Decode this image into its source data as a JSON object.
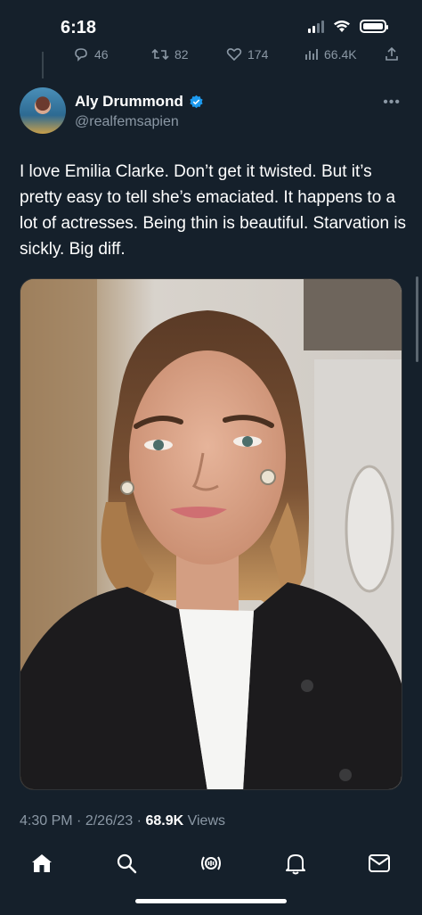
{
  "status_bar": {
    "time": "6:18"
  },
  "previous_tweet_actions": {
    "replies": "46",
    "retweets": "82",
    "likes": "174",
    "views": "66.4K"
  },
  "tweet": {
    "author_name": "Aly Drummond",
    "author_handle": "@realfemsapien",
    "text": "I love Emilia Clarke. Don’t get it twisted. But it’s pretty easy to tell she’s emaciated. It happens to a lot of actresses. Being thin is beautiful. Starvation is sickly. Big diff.",
    "time": "4:30 PM",
    "date": "2/26/23",
    "views_count": "68.9K",
    "views_label": "Views"
  },
  "colors": {
    "background": "#15202b",
    "verified_blue": "#1d9bf0",
    "secondary_text": "#8b98a5"
  },
  "tab_bar": {
    "items": [
      "home-icon",
      "search-icon",
      "spaces-icon",
      "notifications-icon",
      "messages-icon"
    ],
    "active": "home-icon"
  }
}
